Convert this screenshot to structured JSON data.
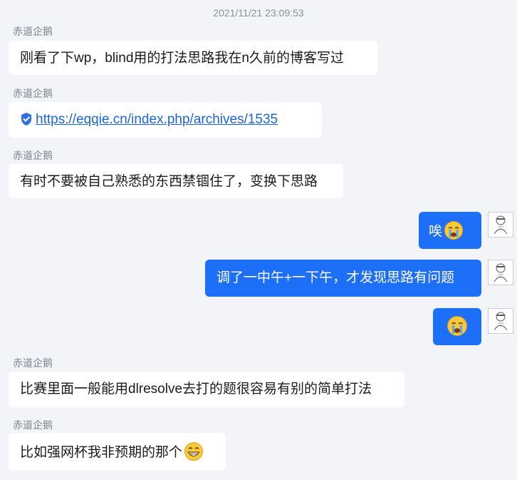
{
  "timestamp": "2021/11/21 23:09:53",
  "sender_name": "赤道企鹅",
  "messages": {
    "m1": "刚看了下wp，blind用的打法思路我在n久前的博客写过",
    "m2_link": "https://eqqie.cn/index.php/archives/1535",
    "m3": "有时不要被自己熟悉的东西禁锢住了，变换下思路",
    "m4": "唉",
    "m5": "调了一中午+一下午，才发现思路有问题",
    "m7": "比赛里面一般能用dlresolve去打的题很容易有别的简单打法",
    "m8": "比如强网杯我非预期的那个"
  },
  "icons": {
    "link_safety": "shield-check-icon",
    "crying_emoji": "crying-face-emoji",
    "grin_emoji": "grinning-face-emoji",
    "avatar": "self-avatar"
  },
  "colors": {
    "background": "#f3f4f7",
    "outgoing_bubble": "#1e6ff7",
    "incoming_bubble": "#ffffff",
    "link": "#1b66d6",
    "shield": "#2f6fe0"
  }
}
